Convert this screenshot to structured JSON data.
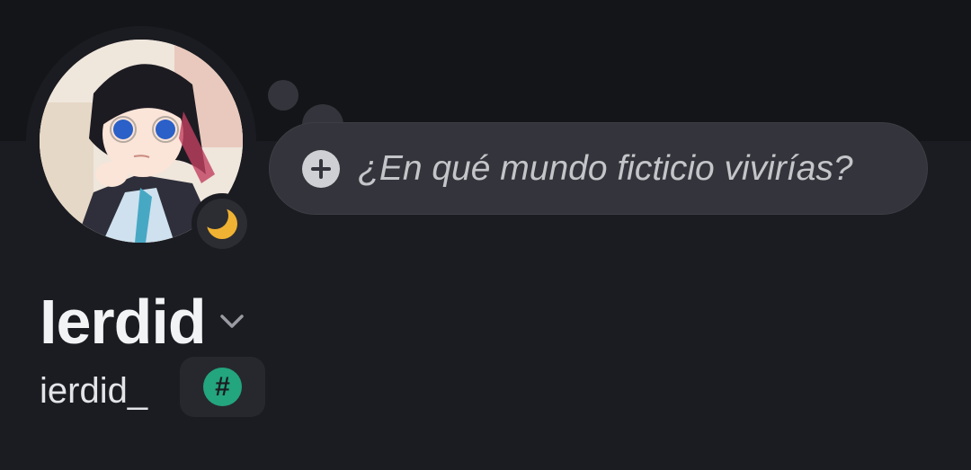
{
  "profile": {
    "display_name": "Ierdid",
    "username": "ierdid_",
    "avatar": "anime-girl-avatar",
    "status_icon": "moon-icon",
    "status_color": "#f0b232",
    "badge_glyph": "#",
    "badge_color": "#23a57e"
  },
  "custom_status": {
    "placeholder": "¿En qué mundo ficticio vivirías?",
    "add_icon": "plus-icon"
  },
  "colors": {
    "background": "#1b1c21",
    "banner": "#141519",
    "bubble": "#34353c"
  }
}
